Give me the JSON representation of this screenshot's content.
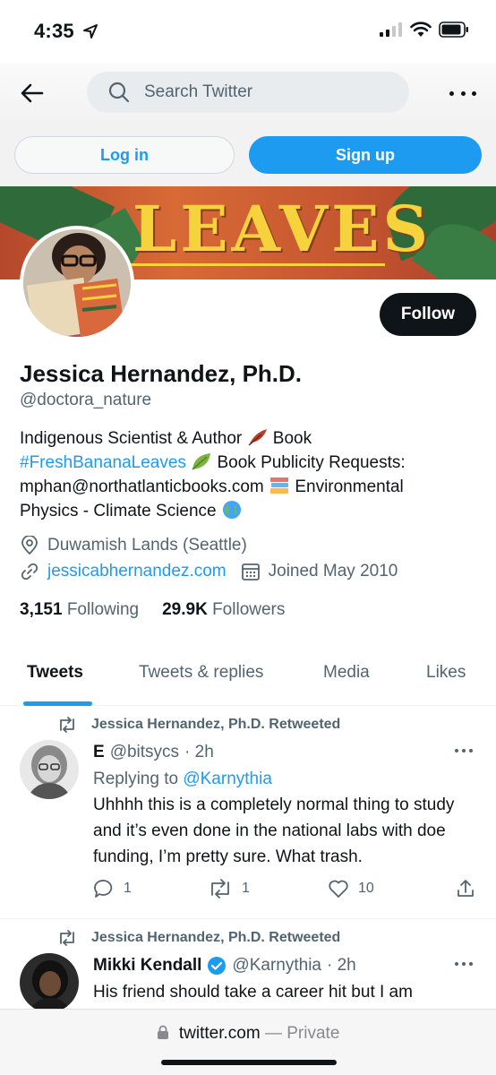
{
  "status_bar": {
    "time": "4:35"
  },
  "search": {
    "placeholder": "Search Twitter"
  },
  "auth": {
    "login_label": "Log in",
    "signup_label": "Sign up"
  },
  "banner": {
    "word": "LEAVES"
  },
  "profile": {
    "follow_label": "Follow",
    "display_name": "Jessica Hernandez, Ph.D.",
    "handle": "@doctora_nature",
    "bio": {
      "line1": "Indigenous Scientist & Author",
      "line1_end": "Book",
      "hashtag": "#FreshBananaLeaves",
      "line2_end": "Book Publicity Requests:",
      "line3_start": "mphan@northatlanticbooks.com",
      "line3_end": "Environmental",
      "line4": "Physics - Climate Science"
    },
    "location": "Duwamish Lands (Seattle)",
    "website": "jessicabhernandez.com",
    "joined": "Joined May 2010",
    "following_count": "3,151",
    "following_label": "Following",
    "followers_count": "29.9K",
    "followers_label": "Followers"
  },
  "tabs": [
    {
      "label": "Tweets"
    },
    {
      "label": "Tweets & replies"
    },
    {
      "label": "Media"
    },
    {
      "label": "Likes"
    }
  ],
  "tweets": [
    {
      "retweeted_by": "Jessica Hernandez, Ph.D. Retweeted",
      "name": "E",
      "handle": "@bitsycs",
      "time": "· 2h",
      "replying_label": "Replying to",
      "replying_handle": "@Karnythia",
      "text": "Uhhhh this is a completely normal thing to study and it’s even done in the national labs with doe funding, I’m pretty sure. What trash.",
      "replies": "1",
      "retweets": "1",
      "likes": "10"
    },
    {
      "retweeted_by": "Jessica Hernandez, Ph.D. Retweeted",
      "name": "Mikki Kendall",
      "handle": "@Karnythia",
      "time": "· 2h",
      "text": "His friend should take a career hit but I am"
    }
  ],
  "browser": {
    "domain": "twitter.com",
    "privacy": "— Private"
  },
  "icons": {
    "back": "arrow-left-icon",
    "search": "search-icon",
    "more": "more-horizontal-icon",
    "location": "location-pin-icon",
    "link": "link-icon",
    "calendar": "calendar-icon",
    "retweet": "retweet-icon",
    "reply": "reply-icon",
    "like": "heart-icon",
    "share": "share-icon",
    "verified": "verified-badge-icon",
    "lock": "lock-icon"
  },
  "colors": {
    "accent": "#1d9bf0",
    "text": "#0f1419",
    "secondary": "#536471"
  }
}
